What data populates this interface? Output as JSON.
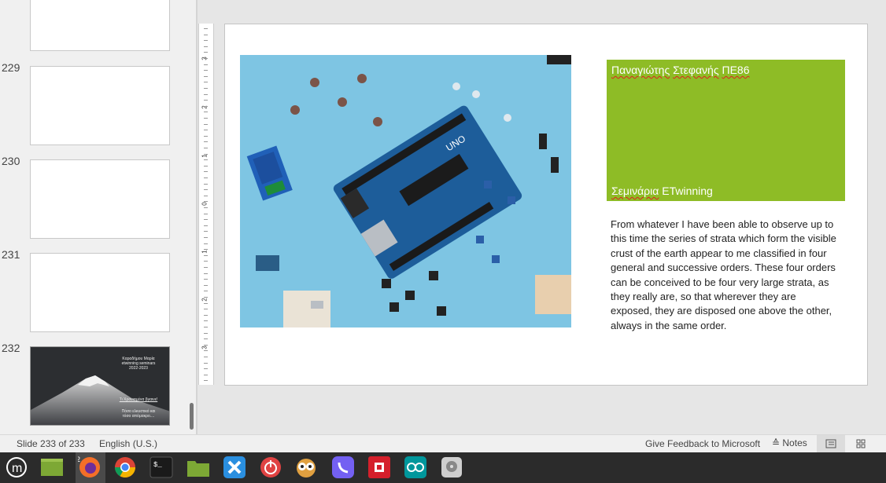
{
  "sidebar": {
    "slides": [
      {
        "number": ""
      },
      {
        "number": "229"
      },
      {
        "number": "230"
      },
      {
        "number": "231"
      },
      {
        "number": "232"
      }
    ],
    "last_thumb": {
      "title_line1": "Καραδήμου Μαρία",
      "title_line2": "etwinning seminars",
      "title_line3": "2022-2023",
      "link_text": "Τι Χρονισμένα βγαινε!",
      "caption_line1": "Πόσο ελκυστικό και",
      "caption_line2": "τόσο απόμακρο...."
    }
  },
  "ruler": {
    "labels": [
      "3",
      "2",
      "1",
      "0",
      "1",
      "2",
      "3"
    ]
  },
  "slide": {
    "title": "Παναγιώτης Στεφανής ΠΕ86",
    "subtitle": "Σεμινάρια ETwinning",
    "body": "From whatever I have been able to observe up to this time the series of strata which form the visible crust of the earth appear to me classified in four general and successive orders. These four orders can be conceived to be four very large strata, as they really are, so that wherever they are exposed, they are disposed one above the other, always in the same order.",
    "image_alt": "Arduino UNO board with electronic components"
  },
  "status_bar": {
    "slide_counter": "Slide 233 of 233",
    "language": "English (U.S.)",
    "feedback": "Give Feedback to Microsoft",
    "notes": "Notes"
  },
  "taskbar": {
    "badge": "2",
    "apps": [
      "linux-mint-menu",
      "show-desktop",
      "firefox",
      "chrome",
      "terminal",
      "files",
      "app-blue",
      "power-app",
      "webcam-app",
      "viber",
      "anydesk-app",
      "arduino",
      "disk-app"
    ]
  },
  "colors": {
    "green_box": "#8ebc26",
    "photo_bg": "#7ec5e3",
    "taskbar": "#2b2b2b"
  }
}
